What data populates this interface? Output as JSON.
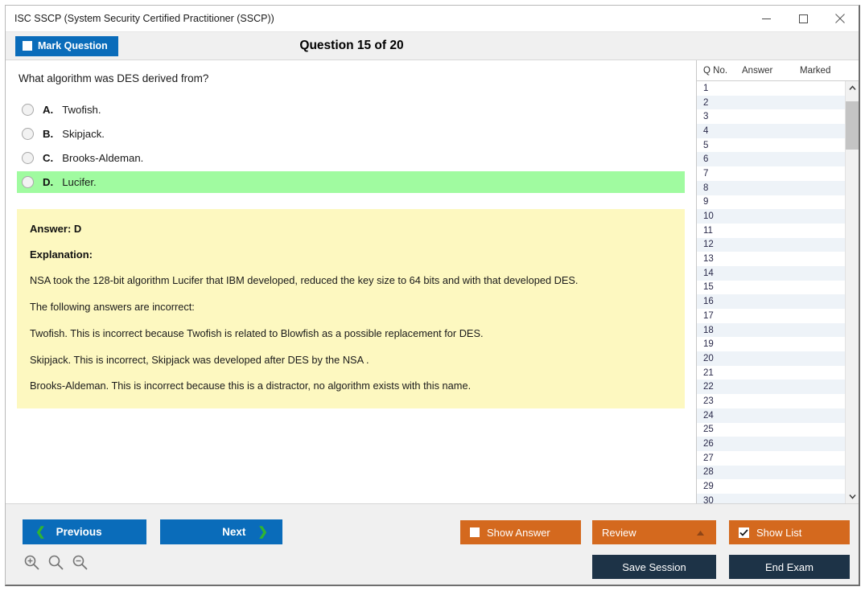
{
  "window": {
    "title": "ISC SSCP (System Security Certified Practitioner (SSCP))",
    "minimize_label": "—",
    "maximize_label": "□",
    "close_label": "✕"
  },
  "header": {
    "mark_question_label": "Mark Question",
    "question_counter": "Question 15 of 20"
  },
  "question": {
    "text": "What algorithm was DES derived from?",
    "options": [
      {
        "letter": "A.",
        "text": "Twofish.",
        "correct": false
      },
      {
        "letter": "B.",
        "text": "Skipjack.",
        "correct": false
      },
      {
        "letter": "C.",
        "text": "Brooks-Aldeman.",
        "correct": false
      },
      {
        "letter": "D.",
        "text": "Lucifer.",
        "correct": true
      }
    ]
  },
  "answer_box": {
    "answer_label": "Answer: D",
    "explanation_label": "Explanation:",
    "lines": [
      "NSA took the 128-bit algorithm Lucifer that IBM developed, reduced the key size to 64 bits and with that developed DES.",
      "The following answers are incorrect:",
      "Twofish. This is incorrect because Twofish is related to Blowfish as a possible replacement for DES.",
      "Skipjack. This is incorrect, Skipjack was developed after DES by the NSA .",
      "Brooks-Aldeman. This is incorrect because this is a distractor, no algorithm exists with this name."
    ]
  },
  "question_list": {
    "columns": [
      "Q No.",
      "Answer",
      "Marked"
    ],
    "rows": [
      {
        "q_no": "1",
        "answer": "",
        "marked": ""
      },
      {
        "q_no": "2",
        "answer": "",
        "marked": ""
      },
      {
        "q_no": "3",
        "answer": "",
        "marked": ""
      },
      {
        "q_no": "4",
        "answer": "",
        "marked": ""
      },
      {
        "q_no": "5",
        "answer": "",
        "marked": ""
      },
      {
        "q_no": "6",
        "answer": "",
        "marked": ""
      },
      {
        "q_no": "7",
        "answer": "",
        "marked": ""
      },
      {
        "q_no": "8",
        "answer": "",
        "marked": ""
      },
      {
        "q_no": "9",
        "answer": "",
        "marked": ""
      },
      {
        "q_no": "10",
        "answer": "",
        "marked": ""
      },
      {
        "q_no": "11",
        "answer": "",
        "marked": ""
      },
      {
        "q_no": "12",
        "answer": "",
        "marked": ""
      },
      {
        "q_no": "13",
        "answer": "",
        "marked": ""
      },
      {
        "q_no": "14",
        "answer": "",
        "marked": ""
      },
      {
        "q_no": "15",
        "answer": "",
        "marked": ""
      },
      {
        "q_no": "16",
        "answer": "",
        "marked": ""
      },
      {
        "q_no": "17",
        "answer": "",
        "marked": ""
      },
      {
        "q_no": "18",
        "answer": "",
        "marked": ""
      },
      {
        "q_no": "19",
        "answer": "",
        "marked": ""
      },
      {
        "q_no": "20",
        "answer": "",
        "marked": ""
      },
      {
        "q_no": "21",
        "answer": "",
        "marked": ""
      },
      {
        "q_no": "22",
        "answer": "",
        "marked": ""
      },
      {
        "q_no": "23",
        "answer": "",
        "marked": ""
      },
      {
        "q_no": "24",
        "answer": "",
        "marked": ""
      },
      {
        "q_no": "25",
        "answer": "",
        "marked": ""
      },
      {
        "q_no": "26",
        "answer": "",
        "marked": ""
      },
      {
        "q_no": "27",
        "answer": "",
        "marked": ""
      },
      {
        "q_no": "28",
        "answer": "",
        "marked": ""
      },
      {
        "q_no": "29",
        "answer": "",
        "marked": ""
      },
      {
        "q_no": "30",
        "answer": "",
        "marked": ""
      }
    ]
  },
  "bottom_bar": {
    "previous_label": "Previous",
    "next_label": "Next",
    "show_answer_label": "Show Answer",
    "review_label": "Review",
    "show_list_label": "Show List",
    "save_session_label": "Save Session",
    "end_exam_label": "End Exam",
    "show_answer_checked": false,
    "show_list_checked": true
  },
  "colors": {
    "primary_blue": "#0a6cba",
    "accent_orange": "#d4691e",
    "dark_navy": "#1d3347",
    "correct_green": "#a0fba0",
    "answer_yellow": "#fdf8c0",
    "chevron_green": "#2fb432"
  }
}
